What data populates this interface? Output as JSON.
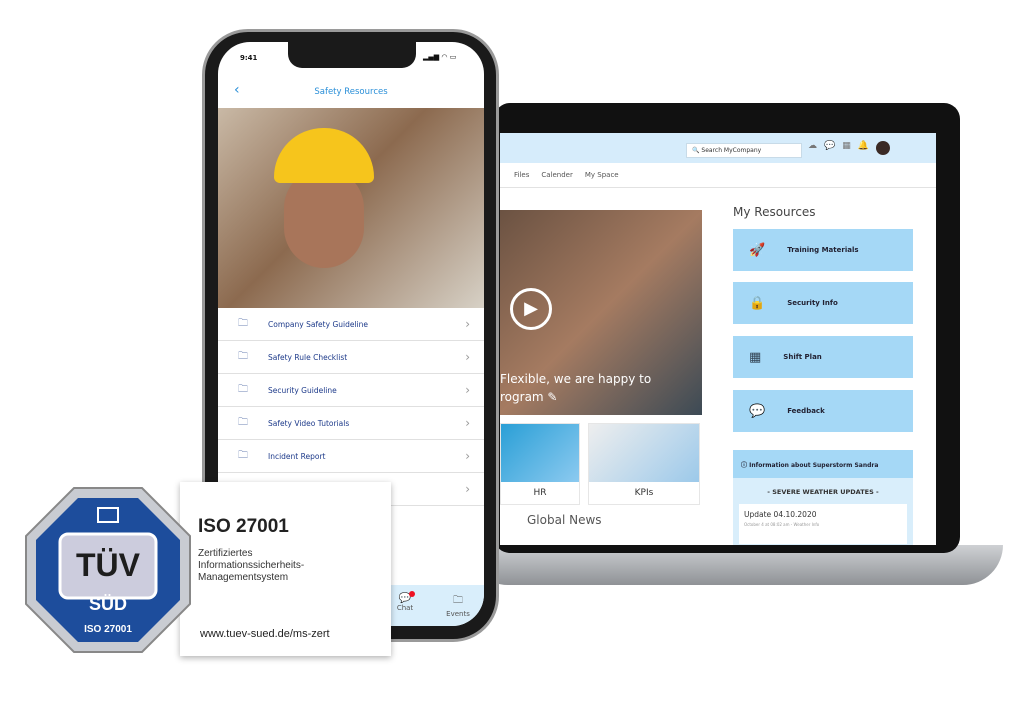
{
  "laptop": {
    "search_placeholder": "Search MyCompany",
    "nav": [
      "Files",
      "Calender",
      "My Space"
    ],
    "video_caption": "Flexible, we are happy to\nrogram ✎",
    "tiles": [
      "HR",
      "KPIs"
    ],
    "global_news": "Global News",
    "my_resources": {
      "title": "My Resources",
      "items": [
        {
          "label": "Training Materials",
          "icon": "rocket-icon"
        },
        {
          "label": "Security Info",
          "icon": "lock-icon"
        },
        {
          "label": "Shift Plan",
          "icon": "calendar-icon"
        },
        {
          "label": "Feedback",
          "icon": "chat-icon"
        }
      ]
    },
    "info": {
      "title": "Information about Superstorm Sandra",
      "subtitle": "- SEVERE WEATHER UPDATES -",
      "update_title": "Update 04.10.2020",
      "update_meta": "October 4 at 08:02 am - Weather Info"
    }
  },
  "phone": {
    "time": "9:41",
    "title": "Safety Resources",
    "items": [
      "Company Safety Guideline",
      "Safety Rule Checklist",
      "Security Guideline",
      "Safety Video Tutorials",
      "Incident Report",
      ""
    ],
    "bottom_nav": [
      "Chat",
      "Events"
    ]
  },
  "badge": {
    "logo_text": "TÜV SÜD",
    "logo_sub": "ISO 27001",
    "title": "ISO 27001",
    "description": "Zertifiziertes\nInformationssicherheits-\nManagementsystem",
    "url": "www.tuev-sued.de/ms-zert",
    "color": "#1d4d9c"
  },
  "colors": {
    "accent": "#a5d8f6",
    "header": "#d6ecfb",
    "link": "#2a8fd8"
  }
}
